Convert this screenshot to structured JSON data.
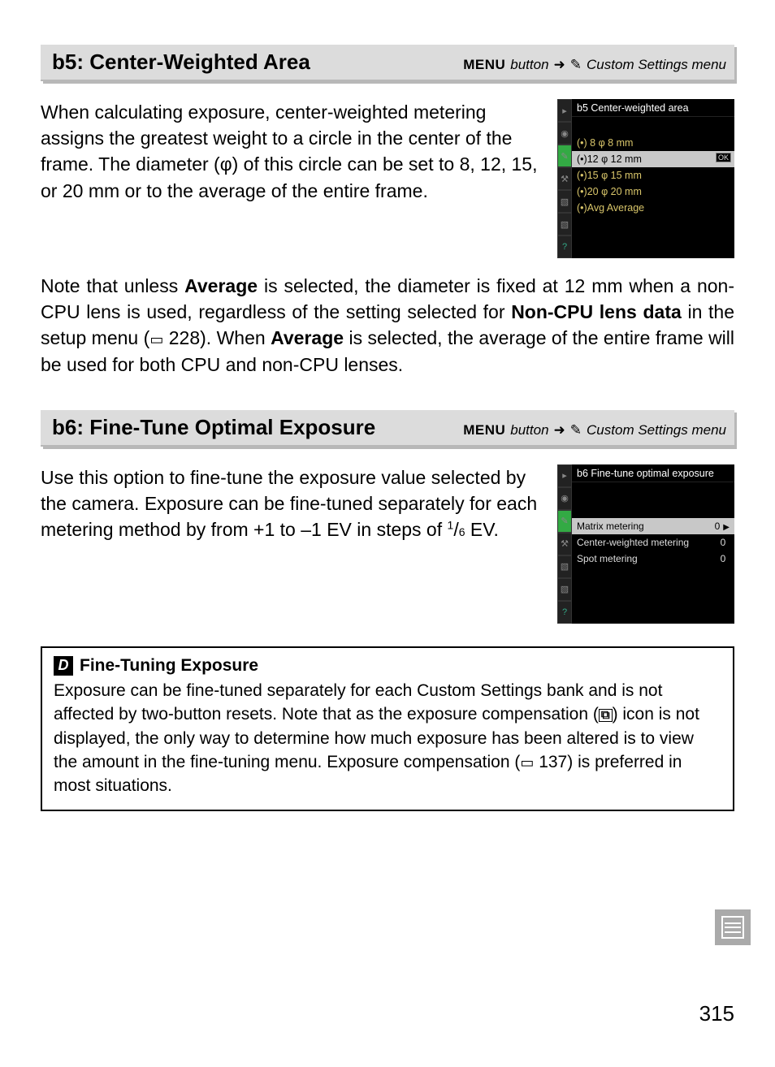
{
  "section_b5": {
    "title": "b5: Center-Weighted Area",
    "menu_label": "MENU",
    "button_word": "button",
    "menu_name": "Custom Settings menu",
    "para1": "When calculating exposure, center-weighted metering assigns the greatest weight to a circle in the center of the frame.  The diameter (φ) of this circle can be set to 8, 12, 15, or 20 mm or to the average of the entire frame.",
    "para2_a": "Note that unless ",
    "para2_avg": "Average",
    "para2_b": " is selected, the diameter is fixed at 12 mm when a non-CPU lens is used, regardless of the setting selected for ",
    "para2_noncpu": "Non-CPU lens data",
    "para2_c": " in the setup menu (",
    "para2_ref": "228",
    "para2_d": "). When ",
    "para2_avg2": "Average",
    "para2_e": " is selected, the average of the entire frame will be used for both CPU and non-CPU lenses."
  },
  "lcd_b5": {
    "title": "b5 Center-weighted area",
    "opt1": "(•) 8   φ  8 mm",
    "opt2": "(•)12  φ 12 mm",
    "opt3": "(•)15  φ 15 mm",
    "opt4": "(•)20  φ 20 mm",
    "opt5": "(•)Avg Average",
    "ok": "OK"
  },
  "section_b6": {
    "title": "b6: Fine-Tune Optimal Exposure",
    "menu_label": "MENU",
    "button_word": "button",
    "menu_name": "Custom Settings menu",
    "para1_a": "Use this option to fine-tune the exposure value selected by the camera.  Exposure can be fine-tuned separately for each metering method by from +1 to –1 EV in steps of ",
    "para1_frac_num": "1",
    "para1_frac_den": "6",
    "para1_b": " EV."
  },
  "lcd_b6": {
    "title": "b6 Fine-tune optimal exposure",
    "row1": "Matrix metering",
    "row1_val": "0",
    "row2": "Center-weighted metering",
    "row2_val": "0",
    "row3": "Spot metering",
    "row3_val": "0"
  },
  "note": {
    "title": "Fine-Tuning Exposure",
    "body_a": "Exposure can be fine-tuned separately for each Custom Settings bank and is not affected by two-button resets.  Note that as the exposure compensation (",
    "body_b": ") icon is not displayed, the only way to determine how much exposure has been altered is to view the amount in the fine-tuning menu.  Exposure compensation (",
    "body_ref": "137",
    "body_c": ") is preferred in most situations."
  },
  "page_number": "315"
}
